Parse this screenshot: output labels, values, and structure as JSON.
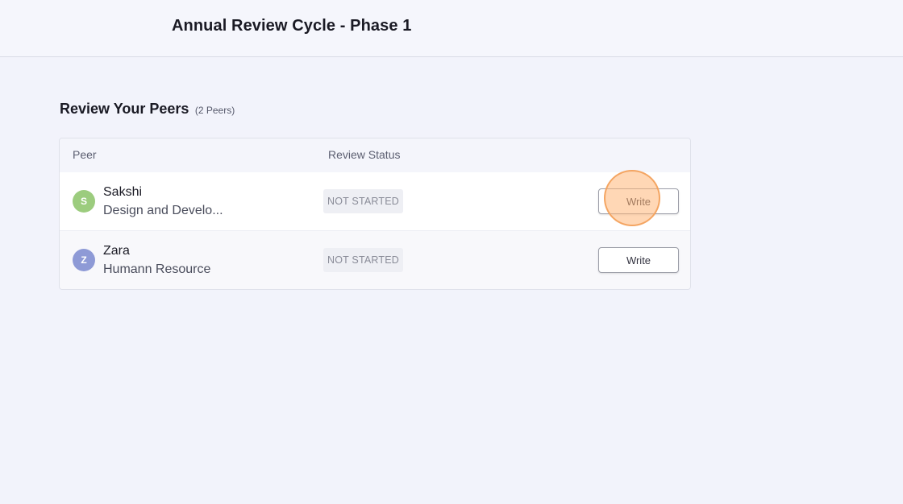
{
  "header": {
    "title": "Annual Review Cycle - Phase 1"
  },
  "section": {
    "title": "Review Your Peers",
    "count": "(2 Peers)"
  },
  "table": {
    "columns": {
      "peer": "Peer",
      "status": "Review Status"
    },
    "rows": [
      {
        "initial": "S",
        "name": "Sakshi",
        "department": "Design and Develo...",
        "status": "NOT STARTED",
        "action": "Write",
        "avatar_color": "#9ccc7e"
      },
      {
        "initial": "Z",
        "name": "Zara",
        "department": "Humann Resource",
        "status": "NOT STARTED",
        "action": "Write",
        "avatar_color": "#8e9ad6"
      }
    ]
  },
  "colors": {
    "background": "#f2f3fb",
    "click_highlight": "#f3a05a"
  }
}
